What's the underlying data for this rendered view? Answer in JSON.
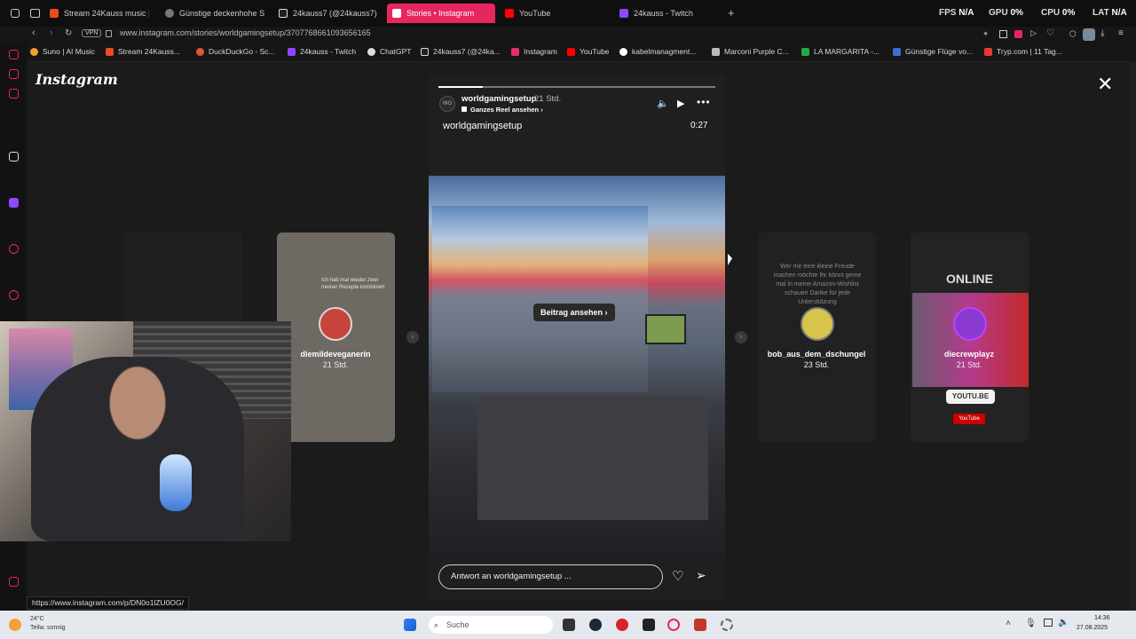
{
  "tabs": [
    {
      "label": "Stream 24Kauss music |",
      "color": "#e94c1e"
    },
    {
      "label": "Günstige deckenhohe Sc",
      "color": "#cccccc"
    },
    {
      "label": "24kauss7 (@24kauss7) |",
      "color": "#ffffff"
    },
    {
      "label": "Stories • Instagram",
      "color": "#ffffff"
    },
    {
      "label": "YouTube",
      "color": "#ff0000"
    },
    {
      "label": "24kauss - Twitch",
      "color": "#9146ff"
    }
  ],
  "stats": [
    {
      "label": "FPS",
      "value": "N/A"
    },
    {
      "label": "GPU",
      "value": "0%"
    },
    {
      "label": "CPU",
      "value": "0%"
    },
    {
      "label": "LAT",
      "value": "N/A"
    }
  ],
  "address": {
    "vpn": "VPN",
    "url": "www.instagram.com/stories/worldgamingsetup/3707768661093656165"
  },
  "bookmarks": [
    {
      "label": "Suno | AI Music",
      "color": "#f0a030"
    },
    {
      "label": "Stream 24Kauss...",
      "color": "#e94c1e"
    },
    {
      "label": "DuckDuckGo - Sc...",
      "color": "#de5833"
    },
    {
      "label": "24kauss - Twitch",
      "color": "#9146ff"
    },
    {
      "label": "ChatGPT",
      "color": "#dddddd"
    },
    {
      "label": "24kauss7 (@24ka...",
      "color": "#ffffff"
    },
    {
      "label": "Instagram",
      "color": "#e1306c"
    },
    {
      "label": "YouTube",
      "color": "#ff0000"
    },
    {
      "label": "kabelmanagment...",
      "color": "#ffffff"
    },
    {
      "label": "Marconi Purple C...",
      "color": "#bbbbbb"
    },
    {
      "label": "LA MARGARITA -...",
      "color": "#27a844"
    },
    {
      "label": "Günstige Flüge vo...",
      "color": "#3b6fd6"
    },
    {
      "label": "Tryp.com | 11 Tag...",
      "color": "#e53935"
    }
  ],
  "page": {
    "logo": "Instagram",
    "close": "✕"
  },
  "story": {
    "username": "worldgamingsetup",
    "time": "21 Std.",
    "reel_link": "Ganzes Reel ansehen",
    "title": "worldgamingsetup",
    "duration": "0:27",
    "progress_fraction": 0.16,
    "view_post": "Beitrag ansehen",
    "reply_placeholder": "Antwort an worldgamingsetup ..."
  },
  "side_stories": [
    {
      "name": "diemildeveganerin",
      "time": "21 Std.",
      "text": "Ich hab mal wieder zwei meiner Rezepte kombiniert"
    },
    {
      "name": "bob_aus_dem_dschungel",
      "time": "23 Std.",
      "text": "Wer mir eine kleine Freude machen möchte Ihr könnt gerne mal in meine Amazon-Wishlist schauen Danke für jede Unterstützung"
    },
    {
      "name": "diecrewplayz",
      "time": "21 Std.",
      "text": "ONLINE",
      "link": "YOUTU.BE",
      "badge": "YouTube"
    }
  ],
  "status_url": "https://www.instagram.com/p/DN0o1lZU0OG/",
  "taskbar": {
    "weather_temp": "24°C",
    "weather_desc": "Teilw. sonnig",
    "search": "Suche",
    "time": "14:36",
    "date": "27.08.2025"
  }
}
